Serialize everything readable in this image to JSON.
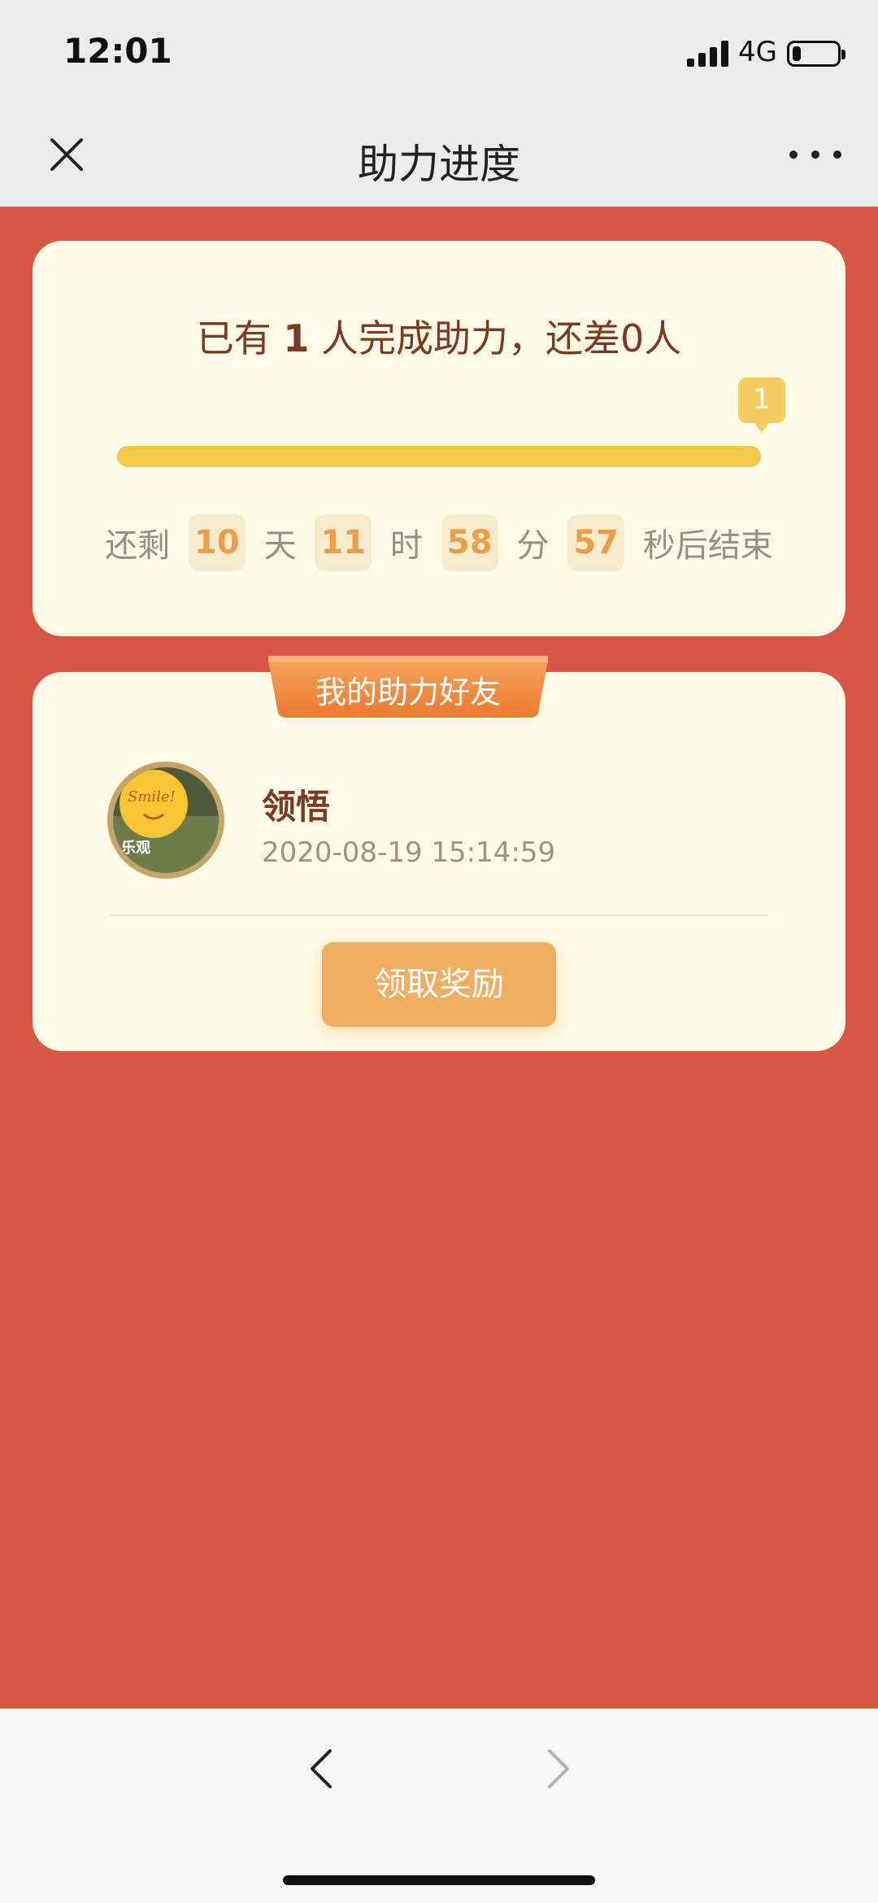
{
  "status_bar": {
    "time": "12:01",
    "network": "4G",
    "battery_percent": 20
  },
  "nav": {
    "title": "助力进度",
    "close_icon": "close-icon",
    "more_icon": "more-icon"
  },
  "progress": {
    "prefix": "已有 ",
    "done_count": "1",
    "suffix": " 人完成助力，还差0人",
    "bubble_value": "1",
    "fill_fraction": 1.0
  },
  "countdown": {
    "label_before": "还剩",
    "days": "10",
    "days_label": "天",
    "hours": "11",
    "hours_label": "时",
    "minutes": "58",
    "minutes_label": "分",
    "seconds": "57",
    "seconds_label": "秒后结束"
  },
  "friends": {
    "banner_title": "我的助力好友",
    "items": [
      {
        "name": "领悟",
        "time": "2020-08-19 15:14:59",
        "avatar_text": "Smile!",
        "avatar_caption": "乐观"
      }
    ],
    "claim_button": "领取奖励"
  },
  "colors": {
    "accent": "#d65744",
    "card": "#fefbe6",
    "progress": "#f6ce60",
    "button": "#f1ae62",
    "text_dark": "#7b3a26"
  }
}
